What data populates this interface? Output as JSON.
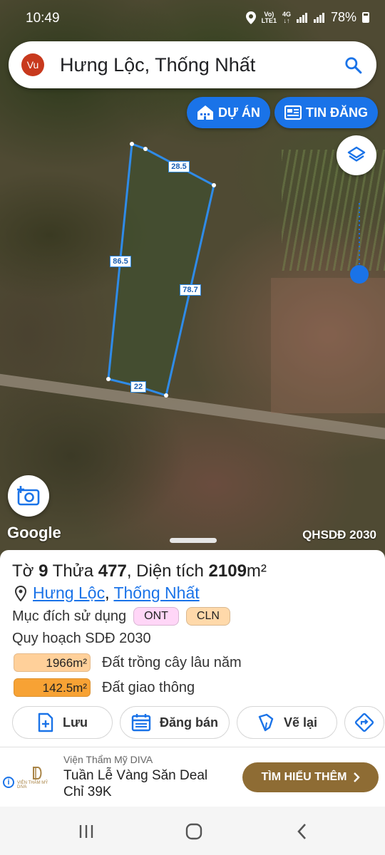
{
  "status_bar": {
    "time": "10:49",
    "network_top": "Vo)",
    "network_bottom": "LTE1",
    "net_type_top": "4G",
    "net_type_bottom": "↓↑",
    "battery": "78%"
  },
  "search": {
    "avatar_initials": "Vu",
    "query": "Hưng Lộc, Thống Nhất"
  },
  "map": {
    "buttons": {
      "project": "DỰ ÁN",
      "listing": "TIN ĐĂNG"
    },
    "parcel_edges": [
      "28.5",
      "86.5",
      "78.7",
      "22"
    ],
    "attribution": "Google",
    "plan_layer": "QHSDĐ 2030",
    "colors": {
      "accent": "#1a73e8",
      "parcel_line": "#2f8be8"
    }
  },
  "parcel": {
    "sheet_prefix": "Tờ",
    "sheet_no": "9",
    "plot_prefix": "Thửa",
    "plot_no": "477",
    "area_prefix": ", Diện tích",
    "area": "2109",
    "area_unit": "m²",
    "location": {
      "commune": "Hưng Lộc",
      "separator": ",",
      "district": "Thống Nhất"
    },
    "usage_label": "Mục đích sử dụng",
    "usage_tags": [
      {
        "code": "ONT",
        "color": "#ffd6f7"
      },
      {
        "code": "CLN",
        "color": "#ffd9aa"
      }
    ],
    "plan_title": "Quy hoạch SDĐ 2030",
    "plan_rows": [
      {
        "area": "1966m²",
        "label": "Đất trồng cây lâu năm",
        "color": "#ffd09a"
      },
      {
        "area": "142.5m²",
        "label": "Đất giao thông",
        "color": "#f7a234"
      }
    ]
  },
  "actions": {
    "save": "Lưu",
    "sell": "Đăng bán",
    "redraw": "Vẽ lại"
  },
  "ad": {
    "sponsor": "Viện Thẩm Mỹ DIVA",
    "headline": "Tuần Lễ Vàng Săn Deal Chỉ 39K",
    "cta": "TÌM HIỂU THÊM",
    "logo_text": "VIỆN THẨM MỸ DIVA",
    "info_symbol": "i"
  }
}
